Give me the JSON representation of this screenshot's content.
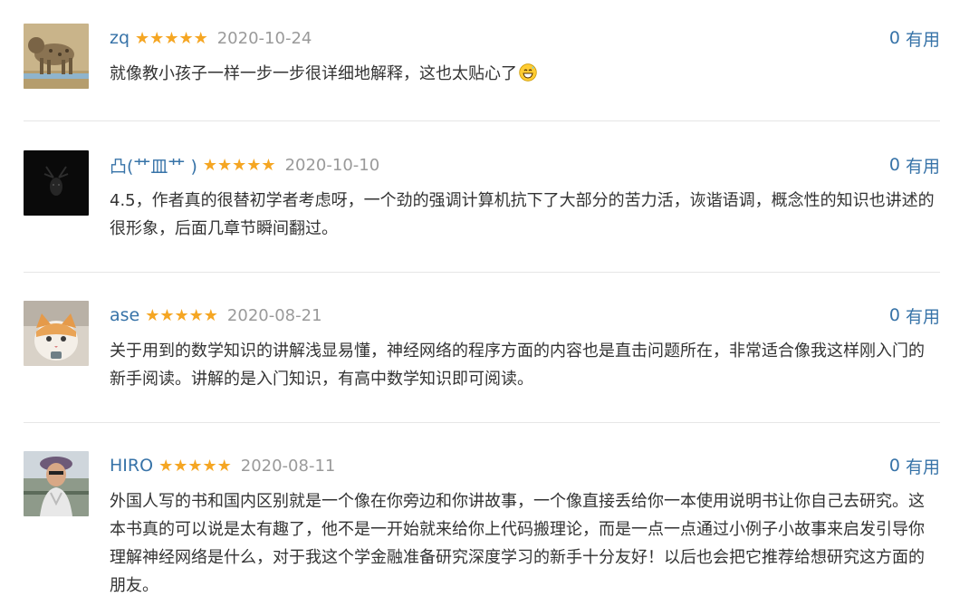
{
  "reviews": [
    {
      "user": "zq",
      "stars": "★★★★★",
      "date": "2020-10-24",
      "useful_count": "0",
      "useful_label": "有用",
      "text": "就像教小孩子一样一步一步很详细地解释，这也太贴心了"
    },
    {
      "user": "凸(艹皿艹 )",
      "stars": "★★★★★",
      "date": "2020-10-10",
      "useful_count": "0",
      "useful_label": "有用",
      "text": "4.5，作者真的很替初学者考虑呀，一个劲的强调计算机抗下了大部分的苦力活，诙谐语调，概念性的知识也讲述的很形象，后面几章节瞬间翻过。"
    },
    {
      "user": "ase",
      "stars": "★★★★★",
      "date": "2020-08-21",
      "useful_count": "0",
      "useful_label": "有用",
      "text": "关于用到的数学知识的讲解浅显易懂，神经网络的程序方面的内容也是直击问题所在，非常适合像我这样刚入门的新手阅读。讲解的是入门知识，有高中数学知识即可阅读。"
    },
    {
      "user": "HIRO",
      "stars": "★★★★★",
      "date": "2020-08-11",
      "useful_count": "0",
      "useful_label": "有用",
      "text": "外国人写的书和国内区别就是一个像在你旁边和你讲故事，一个像直接丢给你一本使用说明书让你自己去研究。这本书真的可以说是太有趣了，他不是一开始就来给你上代码搬理论，而是一点一点通过小例子小故事来启发引导你理解神经网络是什么，对于我这个学金融准备研究深度学习的新手十分友好！以后也会把它推荐给想研究这方面的朋友。"
    }
  ],
  "colors": {
    "link": "#3773a8",
    "star": "#f5a623",
    "date": "#9a9a9a",
    "text": "#333333",
    "divider": "#e6e6e6"
  }
}
